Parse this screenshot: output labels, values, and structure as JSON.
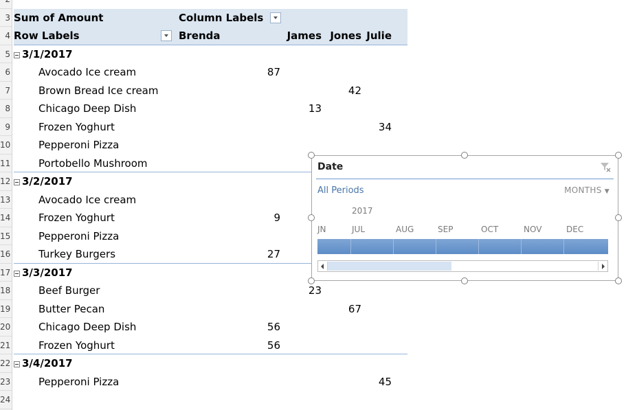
{
  "row_numbers": [
    "2",
    "3",
    "4",
    "5",
    "6",
    "7",
    "8",
    "9",
    "10",
    "11",
    "12",
    "13",
    "14",
    "15",
    "16",
    "17",
    "18",
    "19",
    "20",
    "21",
    "22",
    "23",
    "24"
  ],
  "pivot": {
    "corner_label": "Sum of Amount",
    "column_labels": "Column Labels",
    "row_labels": "Row Labels",
    "columns": [
      "Brenda",
      "James",
      "Jones",
      "Julie"
    ],
    "groups": [
      {
        "date": "3/1/2017",
        "items": [
          {
            "label": "Avocado Ice cream",
            "brenda": "87",
            "james": "",
            "jones": "",
            "julie": ""
          },
          {
            "label": "Brown Bread Ice cream",
            "brenda": "",
            "james": "",
            "jones": "42",
            "julie": ""
          },
          {
            "label": "Chicago Deep Dish",
            "brenda": "",
            "james": "13",
            "jones": "",
            "julie": ""
          },
          {
            "label": "Frozen Yoghurt",
            "brenda": "",
            "james": "",
            "jones": "",
            "julie": "34"
          },
          {
            "label": "Pepperoni Pizza",
            "brenda": "",
            "james": "",
            "jones": "",
            "julie": ""
          },
          {
            "label": "Portobello Mushroom",
            "brenda": "",
            "james": "",
            "jones": "",
            "julie": ""
          }
        ]
      },
      {
        "date": "3/2/2017",
        "items": [
          {
            "label": "Avocado Ice cream",
            "brenda": "",
            "james": "",
            "jones": "",
            "julie": ""
          },
          {
            "label": "Frozen Yoghurt",
            "brenda": "9",
            "james": "",
            "jones": "",
            "julie": ""
          },
          {
            "label": "Pepperoni Pizza",
            "brenda": "",
            "james": "",
            "jones": "",
            "julie": ""
          },
          {
            "label": "Turkey Burgers",
            "brenda": "27",
            "james": "",
            "jones": "",
            "julie": ""
          }
        ]
      },
      {
        "date": "3/3/2017",
        "items": [
          {
            "label": "Beef Burger",
            "brenda": "",
            "james": "23",
            "jones": "",
            "julie": ""
          },
          {
            "label": "Butter Pecan",
            "brenda": "",
            "james": "",
            "jones": "67",
            "julie": ""
          },
          {
            "label": "Chicago Deep Dish",
            "brenda": "56",
            "james": "",
            "jones": "",
            "julie": ""
          },
          {
            "label": "Frozen Yoghurt",
            "brenda": "56",
            "james": "",
            "jones": "",
            "julie": ""
          }
        ]
      },
      {
        "date": "3/4/2017",
        "items": [
          {
            "label": "Pepperoni Pizza",
            "brenda": "",
            "james": "",
            "jones": "",
            "julie": "45"
          }
        ]
      }
    ]
  },
  "timeline": {
    "title": "Date",
    "all_periods": "All Periods",
    "level": "MONTHS",
    "year": "2017",
    "months": [
      "JN",
      "JUL",
      "AUG",
      "SEP",
      "OCT",
      "NOV",
      "DEC"
    ]
  },
  "colors": {
    "header_band": "#dce6f1",
    "group_line": "#95b3d7",
    "timeline_bar": "#5d8cc6",
    "accent_text": "#4a76a8"
  },
  "icons": {
    "clear_filter": "clear-filter-icon",
    "dropdown": "chevron-down-icon",
    "collapse": "minus-box-icon"
  }
}
